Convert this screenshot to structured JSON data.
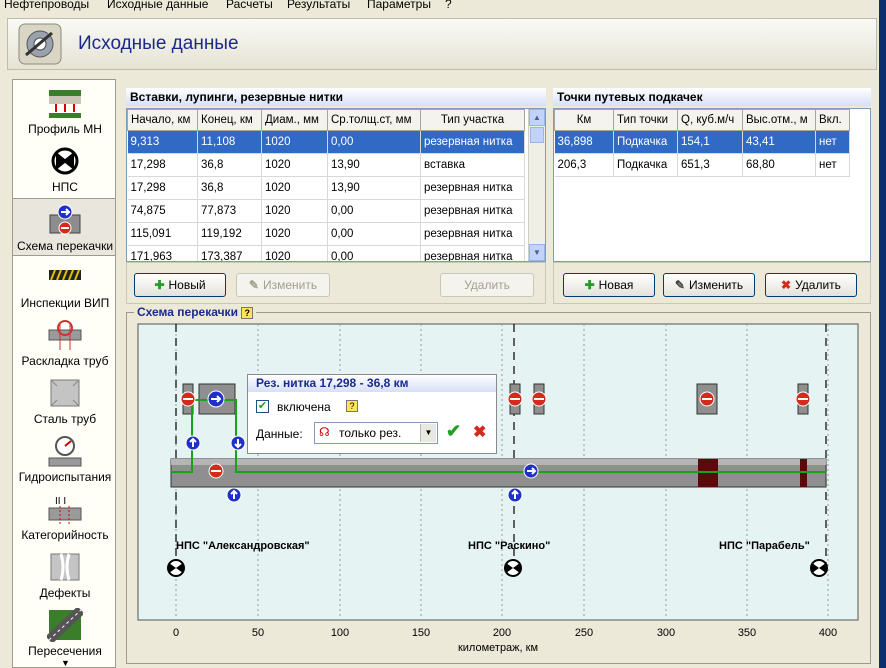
{
  "menu": [
    "Нефтепроводы",
    "Исходные данные",
    "Расчеты",
    "Результаты",
    "Параметры",
    "?"
  ],
  "header": {
    "title": "Исходные данные"
  },
  "sidebar": {
    "items": [
      {
        "label": "Профиль МН",
        "icon": "profile-icon"
      },
      {
        "label": "НПС",
        "icon": "pump-station-icon"
      },
      {
        "label": "Схема перекачки",
        "icon": "pumping-scheme-icon",
        "active": true
      },
      {
        "label": "Инспекции ВИП",
        "icon": "inspection-icon"
      },
      {
        "label": "Раскладка труб",
        "icon": "pipe-layout-icon"
      },
      {
        "label": "Сталь труб",
        "icon": "steel-icon"
      },
      {
        "label": "Гидроиспытания",
        "icon": "gauge-icon"
      },
      {
        "label": "Категорийность",
        "icon": "category-icon"
      },
      {
        "label": "Дефекты",
        "icon": "defect-icon"
      },
      {
        "label": "Пересечения",
        "icon": "crossing-icon"
      }
    ]
  },
  "inserts": {
    "title": "Вставки, лупинги, резервные нитки",
    "columns": [
      "Начало, км",
      "Конец, км",
      "Диам., мм",
      "Ср.толщ.ст, мм",
      "Тип участка"
    ],
    "rows": [
      [
        "9,313",
        "11,108",
        "1020",
        "0,00",
        "резервная нитка"
      ],
      [
        "17,298",
        "36,8",
        "1020",
        "13,90",
        "вставка"
      ],
      [
        "17,298",
        "36,8",
        "1020",
        "13,90",
        "резервная нитка"
      ],
      [
        "74,875",
        "77,873",
        "1020",
        "0,00",
        "резервная нитка"
      ],
      [
        "115,091",
        "119,192",
        "1020",
        "0,00",
        "резервная нитка"
      ],
      [
        "171,963",
        "173,387",
        "1020",
        "0,00",
        "резервная нитка"
      ]
    ],
    "selected_row": 0,
    "buttons": {
      "new": "Новый",
      "edit": "Изменить",
      "delete": "Удалить"
    }
  },
  "pump_points": {
    "title": "Точки путевых подкачек",
    "columns": [
      "Км",
      "Тип точки",
      "Q, куб.м/ч",
      "Выс.отм., м",
      "Вкл."
    ],
    "rows": [
      [
        "36,898",
        "Подкачка",
        "154,1",
        "43,41",
        "нет"
      ],
      [
        "206,3",
        "Подкачка",
        "651,3",
        "68,80",
        "нет"
      ]
    ],
    "selected_row": 0,
    "buttons": {
      "new": "Новая",
      "edit": "Изменить",
      "delete": "Удалить"
    }
  },
  "scheme": {
    "title": "Схема перекачки",
    "xlabel": "километраж, км",
    "ticks": [
      "0",
      "50",
      "100",
      "150",
      "200",
      "250",
      "300",
      "350",
      "400"
    ],
    "stations": [
      "НПС \"Александровская\"",
      "НПС \"Раскино\"",
      "НПС \"Парабель\""
    ],
    "popup": {
      "title": "Рез. нитка 17,298 - 36,8 км",
      "enabled_label": "включена",
      "enabled": true,
      "data_label": "Данные:",
      "data_value": "только рез."
    }
  },
  "colors": {
    "selection": "#316ac5",
    "accent": "#1b2a8c",
    "plot_bg": "#e6f3f3",
    "flow": "#17a317"
  }
}
